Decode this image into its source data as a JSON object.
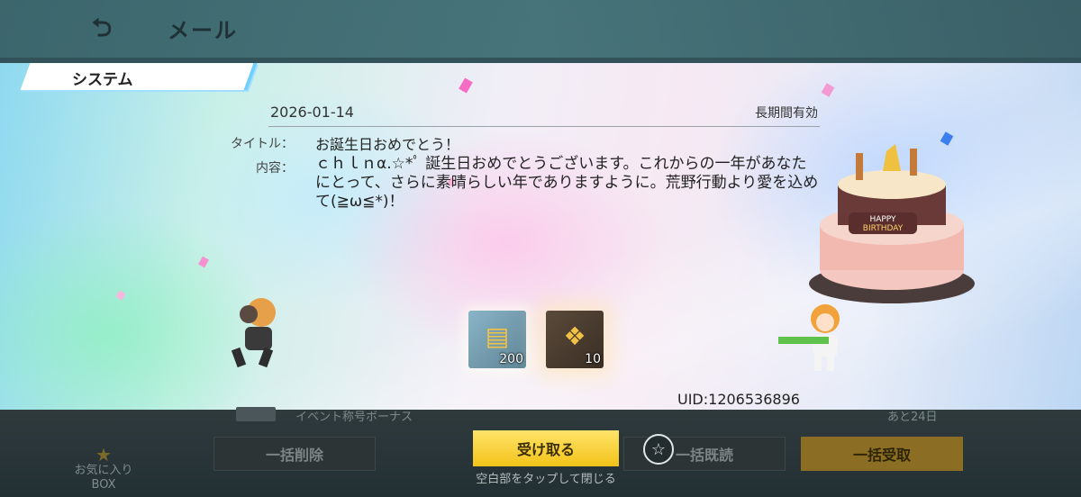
{
  "header": {
    "back_icon": "back-arrow-icon",
    "title": "メール"
  },
  "tab": {
    "label": "システム"
  },
  "mail": {
    "date": "2026-01-14",
    "validity": "長期間有効",
    "title_label": "タイトル：",
    "title": "お誕生日おめでとう！",
    "content_label": "内容：",
    "content": "ｃｈｌｎα.☆*ﾟ 誕生日おめでとうございます。これからの一年があなたにとって、さらに素晴らしい年でありますように。荒野行動より愛を込めて(≧ω≦*)！",
    "rewards": [
      {
        "icon": "gold-voucher-icon",
        "count": "200"
      },
      {
        "icon": "rank-badge-icon",
        "count": "10"
      }
    ],
    "uid": "UID:1206536896"
  },
  "background_list": {
    "item_text": "イベント称号ボーナス",
    "item_date": "あと24日"
  },
  "footer": {
    "favorites_label": "お気に入り",
    "favorites_sublabel": "BOX",
    "favorites_icon": "star-icon",
    "delete_all": "一括削除",
    "receive": "受け取る",
    "read_all": "一括既読",
    "receive_all": "一括受取",
    "hint": "空白部をタップして閉じる",
    "star_button_icon": "star-outline-icon"
  },
  "colors": {
    "receive_button": "#f2c318",
    "receive_all_button": "#8b6e23",
    "tab_accent": "#6fd0ff"
  }
}
